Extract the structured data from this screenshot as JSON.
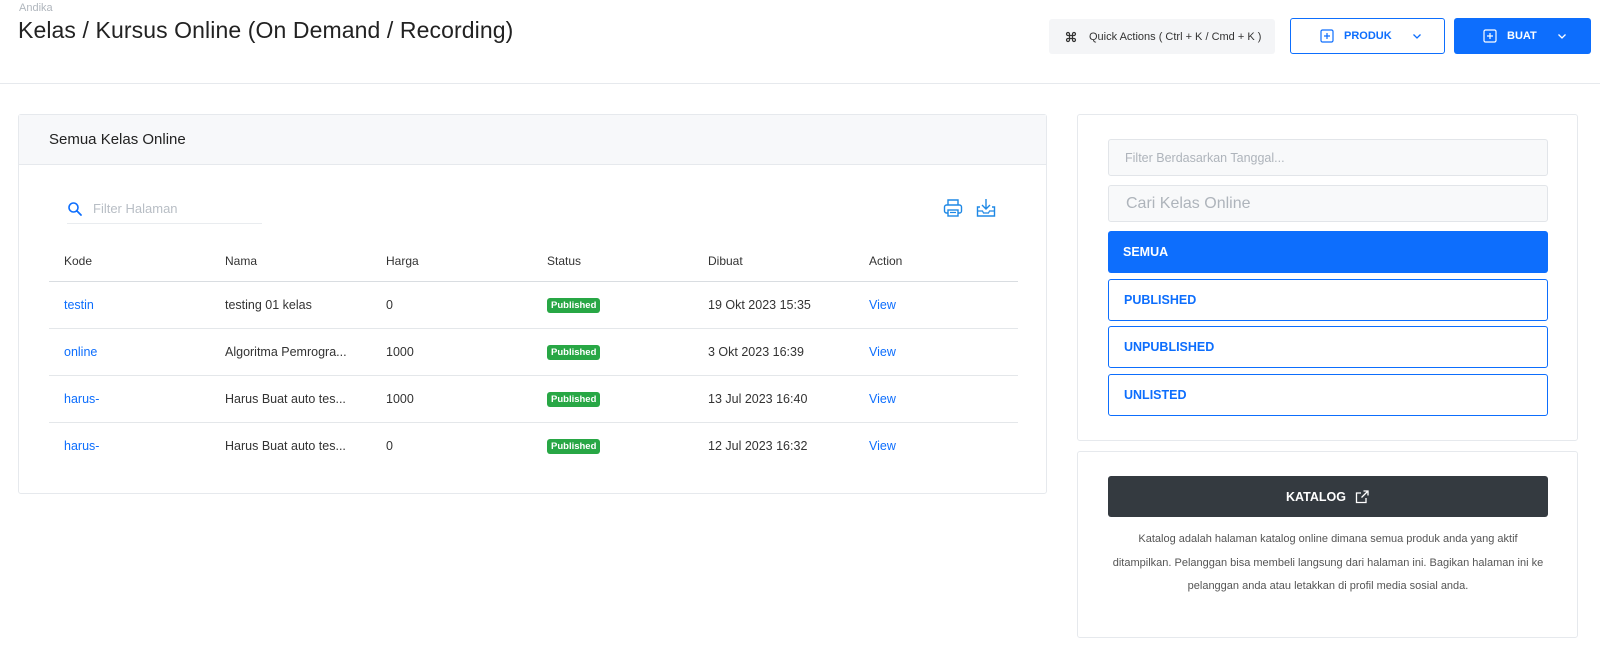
{
  "header": {
    "breadcrumb": "Andika",
    "title": "Kelas / Kursus Online (On Demand / Recording)",
    "quick_actions_label": "Quick Actions ( Ctrl + K / Cmd + K )",
    "produk_label": "PRODUK",
    "buat_label": "BUAT"
  },
  "main": {
    "card_title": "Semua Kelas Online",
    "search_placeholder": "Filter Halaman",
    "columns": [
      "Kode",
      "Nama",
      "Harga",
      "Status",
      "Dibuat",
      "Action"
    ],
    "rows": [
      {
        "kode": "testin",
        "nama": "testing 01 kelas",
        "harga": "0",
        "status": "Published",
        "dibuat": "19 Okt 2023 15:35",
        "action": "View"
      },
      {
        "kode": "online",
        "nama": "Algoritma Pemrogra...",
        "harga": "1000",
        "status": "Published",
        "dibuat": "3 Okt 2023 16:39",
        "action": "View"
      },
      {
        "kode": "harus-",
        "nama": "Harus Buat auto tes...",
        "harga": "1000",
        "status": "Published",
        "dibuat": "13 Jul 2023 16:40",
        "action": "View"
      },
      {
        "kode": "harus-",
        "nama": "Harus Buat auto tes...",
        "harga": "0",
        "status": "Published",
        "dibuat": "12 Jul 2023 16:32",
        "action": "View"
      }
    ]
  },
  "sidebar": {
    "date_filter_placeholder": "Filter Berdasarkan Tanggal...",
    "search_placeholder": "Cari Kelas Online",
    "filters": [
      "SEMUA",
      "PUBLISHED",
      "UNPUBLISHED",
      "UNLISTED"
    ],
    "katalog_label": "KATALOG",
    "katalog_description": "Katalog adalah halaman katalog online dimana semua produk anda yang aktif ditampilkan. Pelanggan bisa membeli langsung dari halaman ini. Bagikan halaman ini ke pelanggan anda atau letakkan di profil media sosial anda."
  },
  "colors": {
    "primary": "#0d6efd",
    "success": "#28a745",
    "dark": "#343a40"
  }
}
